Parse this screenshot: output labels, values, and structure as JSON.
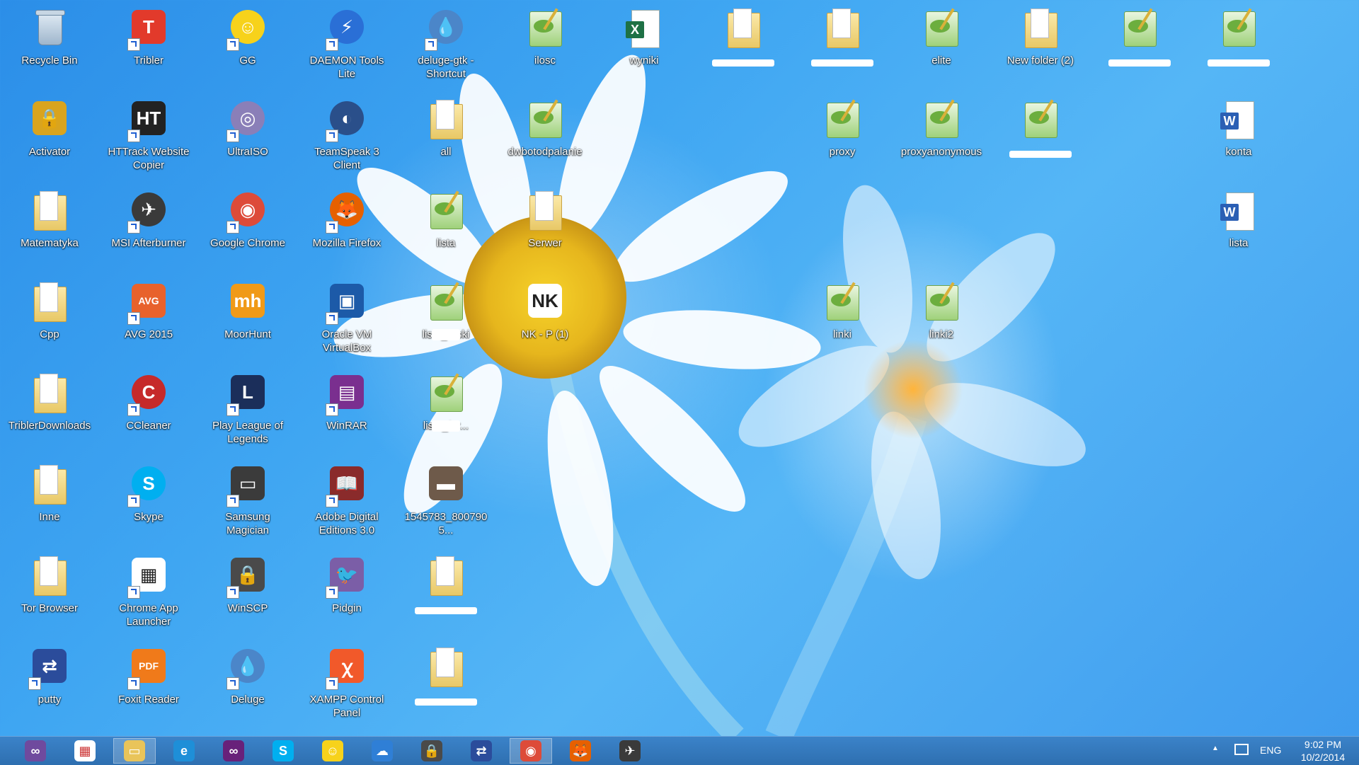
{
  "desktop": {
    "icons": [
      {
        "id": "recycle-bin",
        "label": "Recycle Bin",
        "kind": "recycle",
        "shortcut": false
      },
      {
        "id": "tribler",
        "label": "Tribler",
        "kind": "glyph",
        "color": "#e23a2b",
        "glyph": "T",
        "shortcut": true
      },
      {
        "id": "gg",
        "label": "GG",
        "kind": "glyph",
        "color": "#f7d21b",
        "glyph": "☺",
        "round": true,
        "shortcut": true
      },
      {
        "id": "daemon-tools",
        "label": "DAEMON Tools Lite",
        "kind": "glyph",
        "color": "#2a6fd6",
        "glyph": "⚡",
        "round": true,
        "shortcut": true
      },
      {
        "id": "deluge-gtk",
        "label": "deluge-gtk - Shortcut",
        "kind": "glyph",
        "color": "#4b86c9",
        "glyph": "💧",
        "round": true,
        "shortcut": true
      },
      {
        "id": "ilosc",
        "label": "ilosc",
        "kind": "notepad"
      },
      {
        "id": "wyniki",
        "label": "wyniki",
        "kind": "excel"
      },
      {
        "id": "folder-redacted-1",
        "label": "",
        "kind": "folder",
        "redacted": true
      },
      {
        "id": "folder-redacted-2",
        "label": "",
        "kind": "folder",
        "redacted": true
      },
      {
        "id": "elite",
        "label": "elite",
        "kind": "notepad"
      },
      {
        "id": "new-folder-2",
        "label": "New folder (2)",
        "kind": "folder"
      },
      {
        "id": "np-redacted-1",
        "label": "",
        "kind": "notepad",
        "redacted": true
      },
      {
        "id": "np-redacted-2",
        "label": "",
        "kind": "notepad",
        "redacted": true
      },
      {
        "id": "activator",
        "label": "Activator",
        "kind": "glyph",
        "color": "#d9a41e",
        "glyph": "🔒",
        "shortcut": false
      },
      {
        "id": "httrack",
        "label": "HTTrack Website Copier",
        "kind": "glyph",
        "color": "#222",
        "glyph": "HT",
        "shortcut": true
      },
      {
        "id": "ultraiso",
        "label": "UltraISO",
        "kind": "glyph",
        "color": "#8a7fb8",
        "glyph": "◎",
        "round": true,
        "shortcut": true
      },
      {
        "id": "teamspeak",
        "label": "TeamSpeak 3 Client",
        "kind": "glyph",
        "color": "#2a4f8a",
        "glyph": "◐",
        "round": true,
        "shortcut": true
      },
      {
        "id": "all",
        "label": "all",
        "kind": "folder"
      },
      {
        "id": "dwbotodpalanie",
        "label": "dwbotodpalanie",
        "kind": "notepad"
      },
      {
        "id": "proxy",
        "label": "proxy",
        "kind": "notepad"
      },
      {
        "id": "proxyanonymous",
        "label": "proxyanonymous",
        "kind": "notepad"
      },
      {
        "id": "np-redacted-3",
        "label": "",
        "kind": "notepad",
        "redacted": true
      },
      {
        "id": "konta",
        "label": "konta",
        "kind": "word"
      },
      {
        "id": "matematyka",
        "label": "Matematyka",
        "kind": "folder"
      },
      {
        "id": "msi-afterburner",
        "label": "MSI Afterburner",
        "kind": "glyph",
        "color": "#3a3a3a",
        "glyph": "✈",
        "round": true,
        "shortcut": true
      },
      {
        "id": "google-chrome",
        "label": "Google Chrome",
        "kind": "glyph",
        "color": "#dd4b39",
        "glyph": "◉",
        "round": true,
        "shortcut": true
      },
      {
        "id": "mozilla-firefox",
        "label": "Mozilla Firefox",
        "kind": "glyph",
        "color": "#e66000",
        "glyph": "🦊",
        "round": true,
        "shortcut": true
      },
      {
        "id": "lista-np",
        "label": "lista",
        "kind": "notepad"
      },
      {
        "id": "serwer",
        "label": "Serwer",
        "kind": "folder"
      },
      {
        "id": "lista-word",
        "label": "lista",
        "kind": "word"
      },
      {
        "id": "cpp",
        "label": "Cpp",
        "kind": "folder"
      },
      {
        "id": "avg-2015",
        "label": "AVG 2015",
        "kind": "glyph",
        "color": "#e8622c",
        "glyph": "AVG",
        "shortcut": true
      },
      {
        "id": "moorhunt",
        "label": "MoorHunt",
        "kind": "glyph",
        "color": "#f09a18",
        "glyph": "mh",
        "shortcut": false
      },
      {
        "id": "virtualbox",
        "label": "Oracle VM VirtualBox",
        "kind": "glyph",
        "color": "#1c5aa8",
        "glyph": "▣",
        "shortcut": true
      },
      {
        "id": "lista-ruski",
        "label": "lista_ruski",
        "kind": "notepad",
        "partialRedact": true
      },
      {
        "id": "nk-p1",
        "label": "NK - P (1)",
        "kind": "glyph",
        "color": "#ffffff",
        "glyph": "NK",
        "dark": true
      },
      {
        "id": "linki",
        "label": "linki",
        "kind": "notepad"
      },
      {
        "id": "linki2",
        "label": "linki2",
        "kind": "notepad"
      },
      {
        "id": "triblerdownloads",
        "label": "TriblerDownloads",
        "kind": "folder"
      },
      {
        "id": "ccleaner",
        "label": "CCleaner",
        "kind": "glyph",
        "color": "#c62a2a",
        "glyph": "C",
        "round": true,
        "shortcut": true
      },
      {
        "id": "league",
        "label": "Play League of Legends",
        "kind": "glyph",
        "color": "#1b2e5a",
        "glyph": "L",
        "shortcut": true
      },
      {
        "id": "winrar",
        "label": "WinRAR",
        "kind": "glyph",
        "color": "#7a2f8f",
        "glyph": "▤",
        "shortcut": true
      },
      {
        "id": "lista-for",
        "label": "lista_for...",
        "kind": "notepad",
        "partialRedact": true
      },
      {
        "id": "inne",
        "label": "Inne",
        "kind": "folder"
      },
      {
        "id": "skype",
        "label": "Skype",
        "kind": "glyph",
        "color": "#00aff0",
        "glyph": "S",
        "round": true,
        "shortcut": true
      },
      {
        "id": "samsung-magician",
        "label": "Samsung Magician",
        "kind": "glyph",
        "color": "#3b3b3b",
        "glyph": "▭",
        "shortcut": true
      },
      {
        "id": "adobe-de",
        "label": "Adobe Digital Editions 3.0",
        "kind": "glyph",
        "color": "#8a2b2b",
        "glyph": "📖",
        "shortcut": true
      },
      {
        "id": "img-1545783",
        "label": "1545783_8007905...",
        "kind": "glyph",
        "color": "#6e5a4a",
        "glyph": "▬"
      },
      {
        "id": "tor-browser",
        "label": "Tor Browser",
        "kind": "folder"
      },
      {
        "id": "chrome-app-launcher",
        "label": "Chrome App Launcher",
        "kind": "glyph",
        "color": "#ffffff",
        "glyph": "▦",
        "dark": true,
        "shortcut": true
      },
      {
        "id": "winscp",
        "label": "WinSCP",
        "kind": "glyph",
        "color": "#4a4a4a",
        "glyph": "🔒",
        "shortcut": true
      },
      {
        "id": "pidgin",
        "label": "Pidgin",
        "kind": "glyph",
        "color": "#7b5ea7",
        "glyph": "🐦",
        "shortcut": true
      },
      {
        "id": "folder-redacted-3",
        "label": "",
        "kind": "folder",
        "redacted": true
      },
      {
        "id": "putty",
        "label": "putty",
        "kind": "glyph",
        "color": "#2b4c9b",
        "glyph": "⇄",
        "shortcut": true
      },
      {
        "id": "foxit",
        "label": "Foxit Reader",
        "kind": "glyph",
        "color": "#f07a1a",
        "glyph": "PDF",
        "shortcut": true
      },
      {
        "id": "deluge",
        "label": "Deluge",
        "kind": "glyph",
        "color": "#4b86c9",
        "glyph": "💧",
        "round": true,
        "shortcut": true
      },
      {
        "id": "xampp",
        "label": "XAMPP Control Panel",
        "kind": "glyph",
        "color": "#f1592a",
        "glyph": "ꭓ",
        "shortcut": true
      },
      {
        "id": "folder-redacted-4",
        "label": "",
        "kind": "folder",
        "redacted": true
      }
    ]
  },
  "taskbar": {
    "pinned": [
      {
        "id": "visual-studio-old",
        "color": "#6f4a9e",
        "glyph": "∞"
      },
      {
        "id": "app-launcher",
        "color": "#ffffff",
        "glyph": "▦",
        "dark": true
      },
      {
        "id": "file-explorer",
        "color": "#e9c45a",
        "glyph": "▭",
        "active": true
      },
      {
        "id": "internet-explorer",
        "color": "#1e8fd8",
        "glyph": "e"
      },
      {
        "id": "visual-studio",
        "color": "#68217a",
        "glyph": "∞"
      },
      {
        "id": "skype",
        "color": "#00aff0",
        "glyph": "S"
      },
      {
        "id": "gg",
        "color": "#f7d21b",
        "glyph": "☺"
      },
      {
        "id": "onedrive",
        "color": "#2f7fd6",
        "glyph": "☁"
      },
      {
        "id": "winscp",
        "color": "#4a4a4a",
        "glyph": "🔒"
      },
      {
        "id": "putty",
        "color": "#2b4c9b",
        "glyph": "⇄"
      },
      {
        "id": "chrome",
        "color": "#dd4b39",
        "glyph": "◉",
        "active": true
      },
      {
        "id": "firefox",
        "color": "#e66000",
        "glyph": "🦊"
      },
      {
        "id": "msi-afterburner",
        "color": "#3a3a3a",
        "glyph": "✈"
      }
    ],
    "tray": {
      "chevron": "▲",
      "language": "ENG",
      "time": "9:02 PM",
      "date": "10/2/2014"
    }
  }
}
